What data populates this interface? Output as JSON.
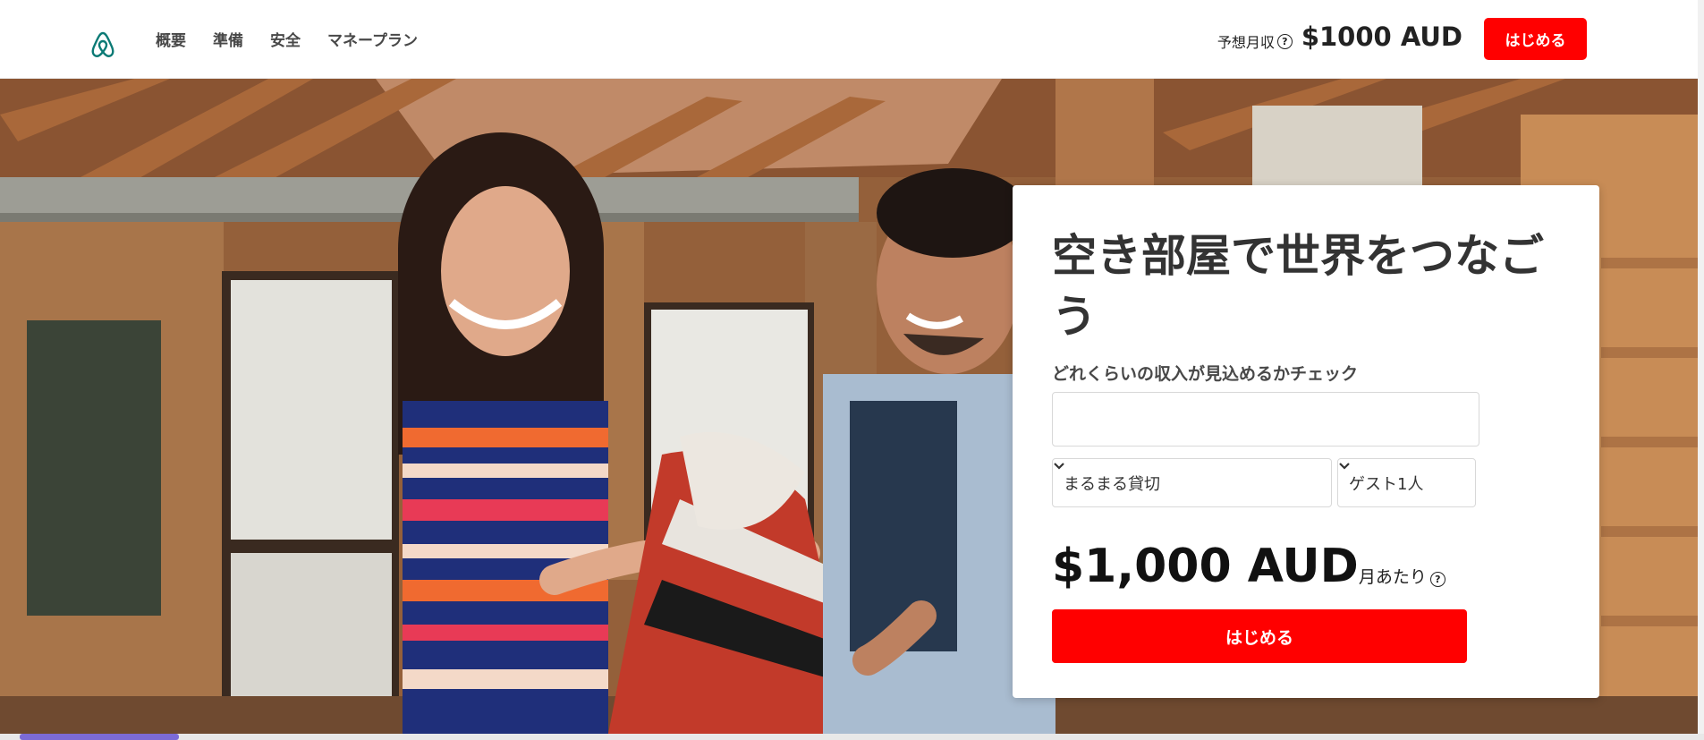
{
  "header": {
    "logo": "airbnb-logo",
    "nav": [
      "概要",
      "準備",
      "安全",
      "マネープラン"
    ],
    "estimate_label": "予想月収",
    "estimate_help": "?",
    "estimate_amount": "$1000 AUD",
    "cta_label": "はじめる"
  },
  "card": {
    "title": "空き部屋で世界をつなごう",
    "subtitle": "どれくらいの収入が見込めるかチェック",
    "address_value": "",
    "property_type": "まるまる貸切",
    "guests": "ゲスト1人",
    "price": "$1,000 AUD",
    "per_month": "月あたり",
    "help": "?",
    "cta_label": "はじめる"
  },
  "colors": {
    "brand_red": "#ff0000",
    "text_dark": "#484848",
    "logo_teal": "#0b7a75"
  },
  "icons": [
    "airbnb-logo",
    "help-circle-icon",
    "chevron-down-icon"
  ]
}
